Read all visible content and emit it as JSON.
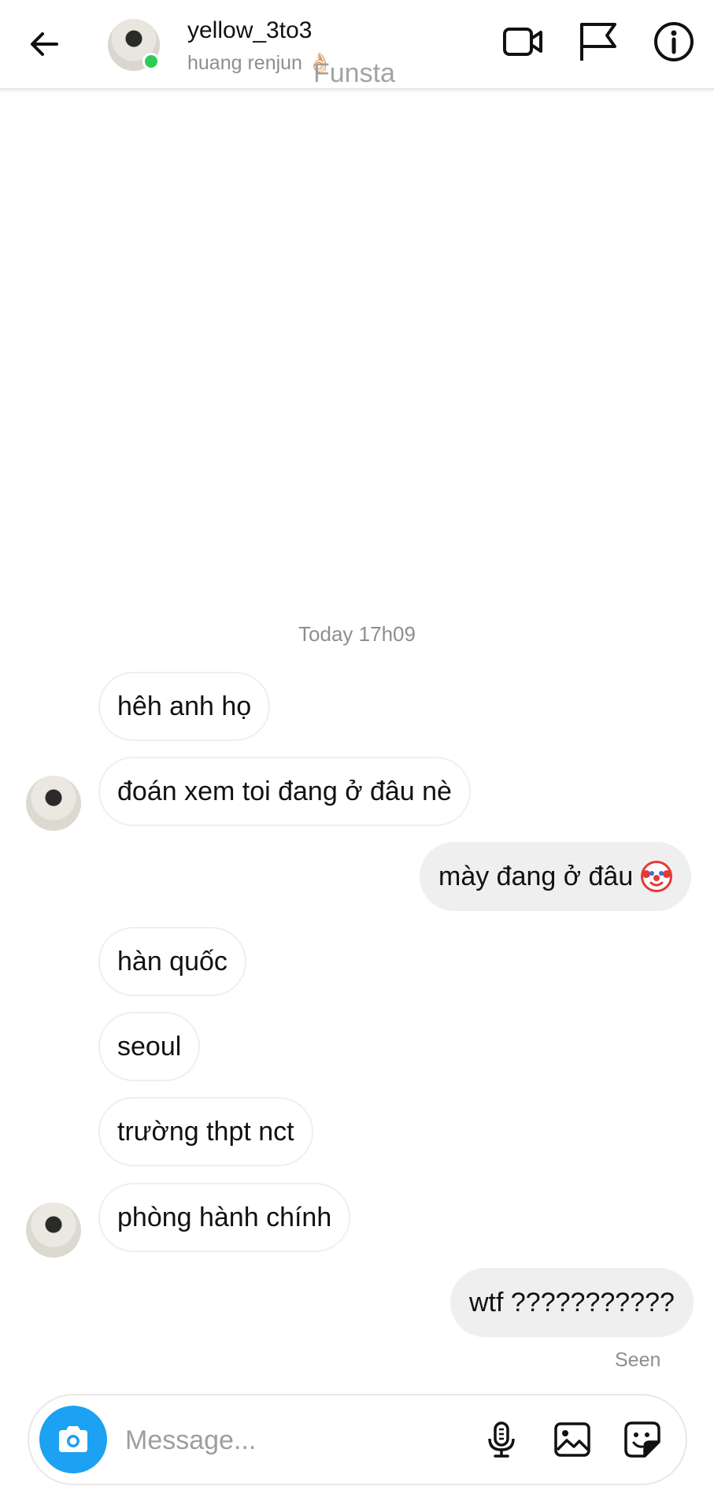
{
  "header": {
    "username": "yellow_3to3",
    "subtitle": "huang renjun 👌🏻",
    "watermark": "Funsta"
  },
  "conversation": {
    "timestamp": "Today 17h09",
    "messages": [
      {
        "side": "in",
        "text": "hêh anh họ"
      },
      {
        "side": "in",
        "text": "đoán xem toi đang ở đâu nè"
      },
      {
        "side": "out",
        "text": "mày đang ở đâu"
      },
      {
        "side": "in",
        "text": "hàn quốc"
      },
      {
        "side": "in",
        "text": "seoul"
      },
      {
        "side": "in",
        "text": "trường thpt nct"
      },
      {
        "side": "in",
        "text": "phòng hành chính"
      },
      {
        "side": "out",
        "text": "wtf ???????????"
      }
    ],
    "seen_label": "Seen"
  },
  "composer": {
    "placeholder": "Message...",
    "value": ""
  },
  "colors": {
    "online": "#2ecc55",
    "camera_button": "#1da1f2",
    "outgoing_bubble": "#efefef"
  },
  "icons": [
    "back-arrow-icon",
    "video-call-icon",
    "flag-icon",
    "info-icon",
    "camera-icon",
    "microphone-icon",
    "gallery-icon",
    "sticker-icon",
    "clown-emoji-icon"
  ]
}
